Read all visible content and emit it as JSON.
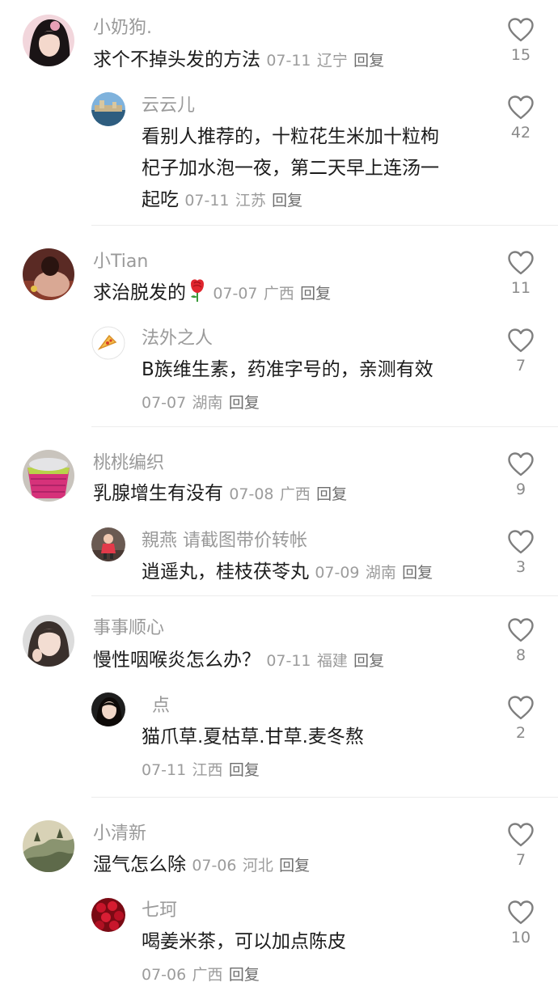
{
  "threads": [
    {
      "comment": {
        "name": "小奶狗.",
        "text": "求个不掉头发的方法",
        "date": "07-11",
        "location": "辽宁",
        "reply": "回复",
        "likes": "15",
        "avatar": "avatar-woman-dark-hair"
      },
      "reply": {
        "name": "云云儿",
        "lines": [
          "看别人推荐的，十粒花生米加十粒枸",
          "杞子加水泡一夜，第二天早上连汤一",
          "起吃"
        ],
        "date": "07-11",
        "location": "江苏",
        "reply": "回复",
        "likes": "42",
        "avatar": "avatar-waterfront"
      }
    },
    {
      "comment": {
        "name": "小Tian",
        "text": "求治脱发的",
        "emoji": "rose-icon",
        "date": "07-07",
        "location": "广西",
        "reply": "回复",
        "likes": "11",
        "avatar": "avatar-woman-back"
      },
      "reply": {
        "name": "法外之人",
        "lines": [
          "B族维生素，药准字号的，亲测有效"
        ],
        "date": "07-07",
        "location": "湖南",
        "reply": "回复",
        "likes": "7",
        "avatar": "avatar-pizza"
      }
    },
    {
      "comment": {
        "name": "桃桃编织",
        "text": "乳腺增生有没有",
        "date": "07-08",
        "location": "广西",
        "reply": "回复",
        "likes": "9",
        "avatar": "avatar-woven-basket"
      },
      "reply": {
        "name": "親燕 请截图带价转帐",
        "lines": [
          "逍遥丸，桂枝茯苓丸"
        ],
        "date": "07-09",
        "location": "湖南",
        "reply": "回复",
        "likes": "3",
        "avatar": "avatar-child"
      }
    },
    {
      "comment": {
        "name": "事事顺心",
        "text": "慢性咽喉炎怎么办？",
        "date": "07-11",
        "location": "福建",
        "reply": "回复",
        "likes": "8",
        "avatar": "avatar-woman-portrait"
      },
      "reply": {
        "name": "点",
        "lines": [
          "猫爪草.夏枯草.甘草.麦冬熬"
        ],
        "date": "07-11",
        "location": "江西",
        "reply": "回复",
        "likes": "2",
        "avatar": "avatar-woman-dark"
      }
    },
    {
      "comment": {
        "name": "小清新",
        "text": "湿气怎么除",
        "date": "07-06",
        "location": "河北",
        "reply": "回复",
        "likes": "7",
        "avatar": "avatar-landscape-painting"
      },
      "reply": {
        "name": "七珂",
        "lines": [
          "喝姜米茶，可以加点陈皮"
        ],
        "date": "07-06",
        "location": "广西",
        "reply": "回复",
        "likes": "10",
        "avatar": "avatar-roses"
      }
    }
  ],
  "icons": {
    "like": "heart-outline-icon"
  },
  "colors": {
    "name": "#9a9a9a",
    "text": "#1c1c1c",
    "meta": "#9c9c9c",
    "heart": "#8a8a8a",
    "divider": "#ececec"
  }
}
